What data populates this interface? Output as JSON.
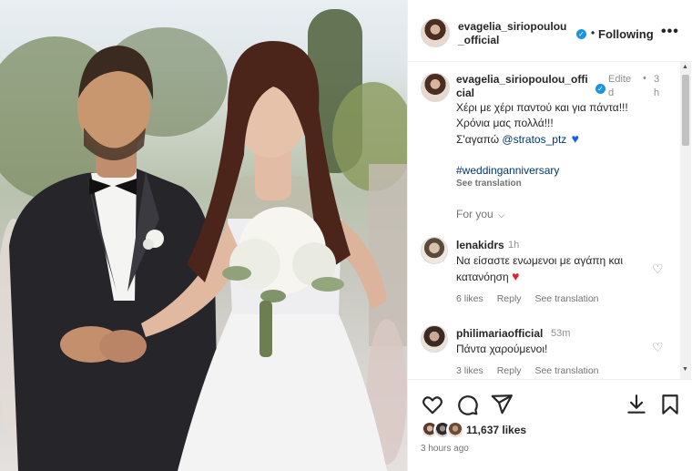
{
  "post": {
    "username": "evagelia_siriopoulou_official",
    "username_display": "evagelia_siriopoulou\n_official",
    "follow_label": "Following",
    "dot": "•",
    "more": "•••"
  },
  "caption": {
    "username_display": "evagelia_siriopoulou_offi\ncial",
    "edited": "Edite\nd",
    "dot": "•",
    "time": "3\nh",
    "lines": [
      "Χέρι με χέρι παντού και για πάντα!!!",
      "Χρόνια μας πολλά!!!",
      "Σ'αγαπώ"
    ],
    "mention": "@stratos_ptz",
    "heart": "♥",
    "hashtag": "#weddinganniversary",
    "see_translation": "See translation",
    "for_you": "For you",
    "for_you_chevron": "⌵"
  },
  "comments": [
    {
      "username": "lenakidrs",
      "time": "1h",
      "text_line1": "Να είσαστε ενωμενοι με αγάπη και",
      "text_line2": "κατανόηση",
      "heart": "♥",
      "likes": "6 likes",
      "reply": "Reply",
      "see_translation": "See translation",
      "like_icon": "♡"
    },
    {
      "username": "philimariaofficial",
      "time": "53m",
      "text_line1": "Πάντα χαρούμενοι!",
      "likes": "3 likes",
      "reply": "Reply",
      "see_translation": "See translation",
      "like_icon": "♡"
    }
  ],
  "scrollbar": {
    "up": "▲",
    "down": "▼"
  },
  "footer": {
    "likes": "11,637 likes",
    "posted": "3 hours ago"
  },
  "colors": {
    "verified": "#1b95e0",
    "link": "#00376b",
    "heart_blue": "#1c5fd8",
    "heart_red": "#e0212e",
    "muted": "#737373"
  },
  "icons": [
    "heart-icon",
    "comment-icon",
    "share-icon",
    "download-icon",
    "bookmark-icon",
    "verified-icon",
    "more-icon"
  ]
}
